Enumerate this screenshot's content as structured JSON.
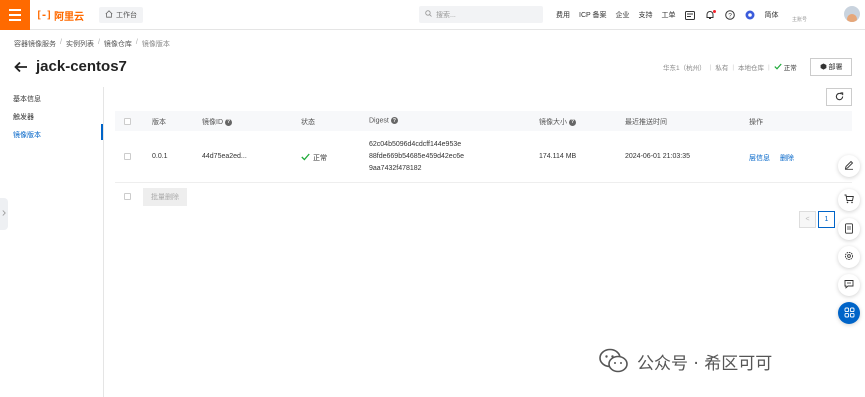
{
  "topbar": {
    "logo_text": "阿里云",
    "workbench_label": "工作台",
    "search_placeholder": "搜索...",
    "links": [
      "费用",
      "ICP 备案",
      "企业",
      "支持",
      "工单"
    ],
    "language": "简体",
    "user_sub": "主账号",
    "brand_color": "#ff6a00"
  },
  "breadcrumb": [
    "容器镜像服务",
    "实例列表",
    "镜像仓库",
    "镜像版本"
  ],
  "header": {
    "title": "jack-centos7",
    "region": "华东1（杭州）",
    "visibility": "私有",
    "repo_type": "本地仓库",
    "status": "正常",
    "deploy_label": "部署"
  },
  "leftnav": {
    "items": [
      "基本信息",
      "触发器",
      "镜像版本"
    ],
    "active_index": 2
  },
  "table": {
    "columns": [
      "版本",
      "镜像ID",
      "状态",
      "Digest",
      "镜像大小",
      "最近推送时间",
      "操作"
    ],
    "rows": [
      {
        "version": "0.0.1",
        "image_id": "44d75ea2ed...",
        "status": "正常",
        "digest_lines": [
          "62c04b5096d4cdcff144e953e",
          "88fde669b54685e459d42ec6e",
          "9aa7432f478182"
        ],
        "size": "174.114 MB",
        "pushed_at": "2024-06-01 21:03:35",
        "action_info": "层信息",
        "action_delete": "删除"
      }
    ],
    "batch_delete_label": "批量删除"
  },
  "pager": {
    "prev": "<",
    "current": "1",
    "next": ">"
  },
  "watermark": {
    "text": "公众号 · 希区可可"
  },
  "colors": {
    "accent": "#0064c8",
    "ok": "#1eaa39"
  }
}
